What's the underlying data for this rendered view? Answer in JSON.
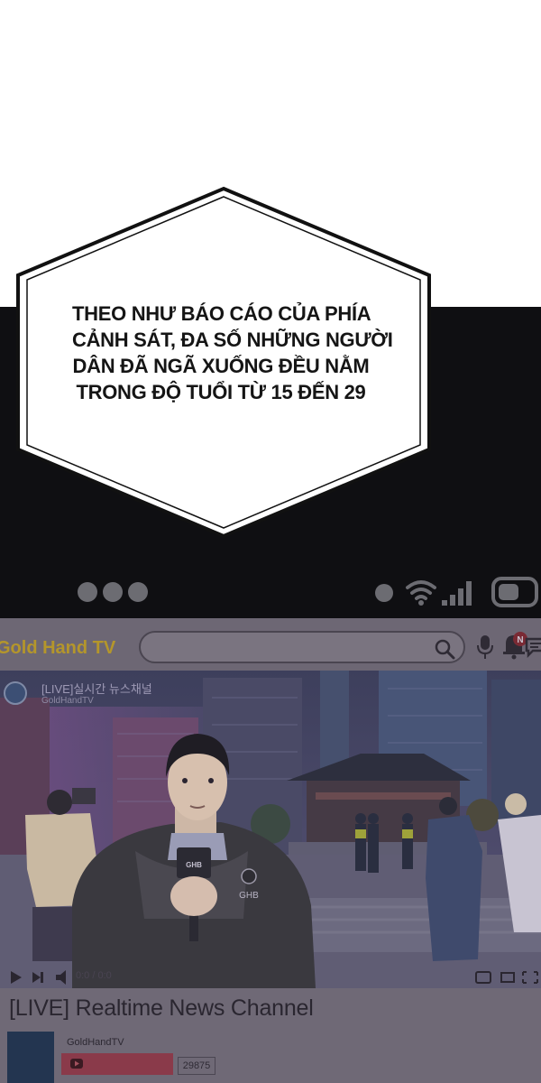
{
  "speech_bubble": {
    "lines": [
      "THEO NHƯ BÁO CÁO CỦA PHÍA",
      "CẢNH SÁT, ĐA SỐ NHỮNG NGƯỜI",
      "DÂN ĐÃ NGÃ XUỐNG ĐỀU NẰM",
      "TRONG ĐỘ TUỔI TỪ 15 ĐẾN 29"
    ]
  },
  "status_bar": {
    "icons": [
      "more-dots-icon",
      "wifi-icon",
      "signal-icon",
      "battery-icon"
    ]
  },
  "app": {
    "brand": "Gold Hand TV",
    "search": {
      "placeholder": ""
    },
    "icons": [
      "search-icon",
      "mic-icon",
      "bell-icon",
      "message-icon"
    ],
    "notification_badge": "N",
    "video": {
      "overlay_title": "[LIVE]실시간  뉴스채널",
      "overlay_subtitle": "GoldHandTV",
      "mic_logo": "GHB",
      "jacket_logo": "GHB",
      "time": "0:0  / 0:0"
    },
    "video_title": "[LIVE] Realtime News Channel",
    "channel_name": "GoldHandTV",
    "subscriber_count": "29875"
  },
  "colors": {
    "background_top": "#ffffff",
    "dark_band": "#0f0f12",
    "app_overlay": "#6f6976",
    "brand": "#b4962b",
    "subscribe": "#8a3a4a"
  }
}
